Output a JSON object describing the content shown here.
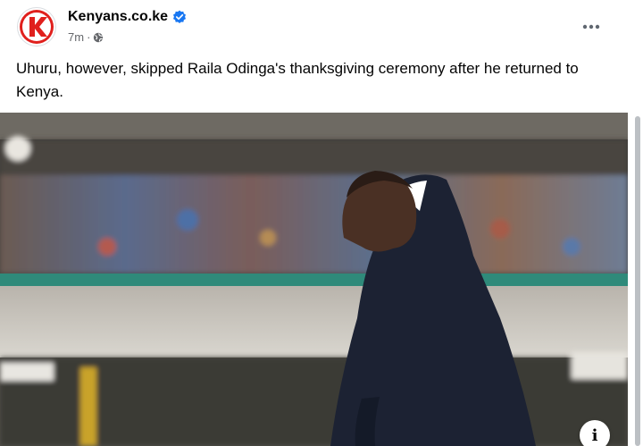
{
  "post": {
    "page_name": "Kenyans.co.ke",
    "timestamp": "7m",
    "separator": "·",
    "text": "Uhuru, however, skipped Raila Odinga's thanksgiving ceremony after he returned to Kenya.",
    "logo_letter": "K",
    "info_label": "i"
  },
  "icons": {
    "verified": "verified-badge-icon",
    "audience": "globe-icon",
    "more": "more-options-icon",
    "info": "info-icon"
  },
  "colors": {
    "brand_red": "#e0201d",
    "verified_blue": "#1877f2",
    "text_primary": "#050505",
    "text_secondary": "#65676b"
  }
}
